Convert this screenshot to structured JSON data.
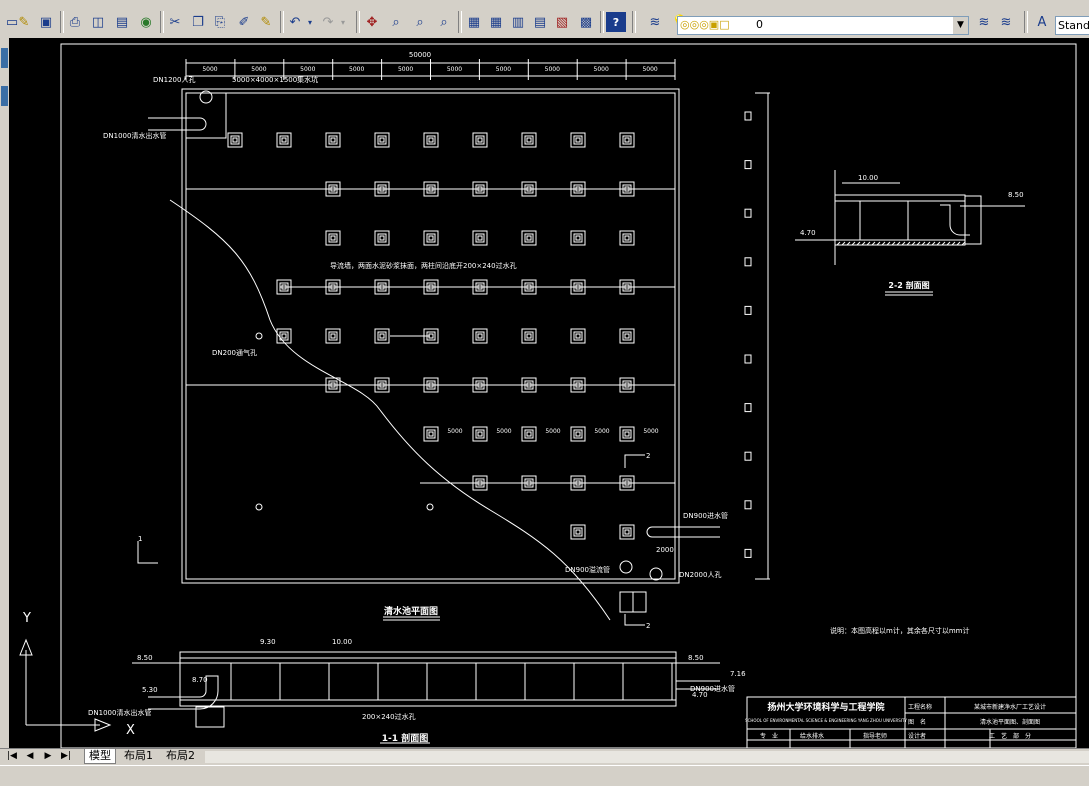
{
  "window": {
    "layer_value": "0",
    "text_style": "Stand"
  },
  "tabs": {
    "model": "模型",
    "layout1": "布局1",
    "layout2": "布局2"
  },
  "drawing": {
    "plan_title": "清水池平面图",
    "section11_title": "1-1 剖面图",
    "section22_title": "2-2 剖面图",
    "top_total_dim": "50000",
    "top_segment_dims": [
      "5000",
      "5000",
      "5000",
      "5000",
      "5000",
      "5000",
      "5000",
      "5000",
      "5000",
      "5000"
    ],
    "mid_segment_dims": [
      "5000",
      "5000",
      "5000",
      "5000",
      "5000"
    ],
    "labels": {
      "dn1200": "DN1200人孔",
      "sump": "5000×4000×1500集水坑",
      "dn1000_out": "DN1000清水出水管",
      "baffle": "导流墙，两面水泥砂浆抹面，两柱间沿底开200×240过水孔",
      "dn200": "DN200通气孔",
      "dn900_in": "DN900进水管",
      "dn900_over": "DN900溢流管",
      "dn2000": "DN2000人孔",
      "dim2000": "2000",
      "section_mark_1": "1",
      "section_mark_2": "2",
      "note": "说明：本图高程以m计，其余各尺寸以mm计",
      "s1_930": "9.30",
      "s1_1000": "10.00",
      "s1_850a": "8.50",
      "s1_870": "8.70",
      "s1_530": "5.30",
      "s1_850b": "8.50",
      "s1_716": "7.16",
      "s1_470": "4.70",
      "s1_hole": "200×240过水孔",
      "s1_dn1000": "DN1000清水出水管",
      "s1_dn900": "DN900进水管",
      "s2_1000": "10.00",
      "s2_850": "8.50",
      "s2_470": "4.70",
      "axis_y": "Y",
      "axis_x": "X"
    },
    "title_block": {
      "school": "扬州大学环境科学与工程学院",
      "school_en": "SCHOOL OF ENVIRONMENTAL SCIENCE & ENGINEERING  YANG ZHOU UNIVERSITY",
      "project_label": "工程名称",
      "project_value": "某城市新建净水厂工艺设计",
      "drawing_label": "图　名",
      "drawing_value": "清水池平面图、剖面图",
      "major": "专　业",
      "major_value": "给水排水",
      "teacher": "指导老师",
      "designer": "设计者",
      "process": "工　艺　部　分"
    }
  }
}
